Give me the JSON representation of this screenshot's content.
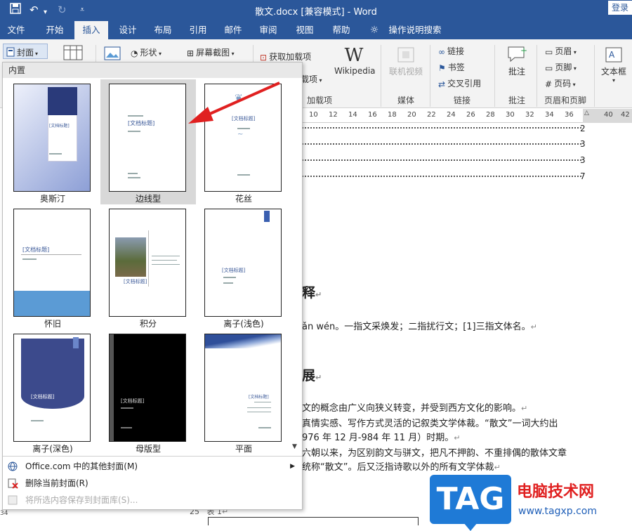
{
  "title_bar": {
    "doc_title": "散文.docx [兼容模式]  -  Word",
    "login": "登录"
  },
  "ribbon_tabs": [
    "文件",
    "开始",
    "插入",
    "设计",
    "布局",
    "引用",
    "邮件",
    "审阅",
    "视图",
    "帮助",
    "操作说明搜索"
  ],
  "ribbon": {
    "cover": "封面",
    "shapes": "形状",
    "screenshot": "屏幕截图",
    "get_addins": "获取加载项",
    "my_addins": "载项",
    "addins_group": "加载项",
    "wikipedia": "Wikipedia",
    "online_video": "联机视频",
    "media_group": "媒体",
    "link": "链接",
    "bookmark": "书签",
    "cross_ref": "交叉引用",
    "links_group": "链接",
    "comment": "批注",
    "comment_group": "批注",
    "header": "页眉",
    "footer": "页脚",
    "page_number": "页码",
    "hf_group": "页眉和页脚",
    "textbox": "文本框"
  },
  "ruler_ticks": [
    "10",
    "12",
    "14",
    "16",
    "18",
    "20",
    "22",
    "24",
    "26",
    "28",
    "30",
    "32",
    "34",
    "36",
    "40",
    "42"
  ],
  "toc_numbers": [
    "2",
    "3",
    "3",
    "7"
  ],
  "document": {
    "heading1": "释",
    "line1": "ǎn wén。一指文采焕发；二指扰行文；[1]三指文体名。",
    "heading2": "展",
    "line2": "文的概念由广义向狭义转变，并受到西方文化的影响。",
    "line3": "真情实感、写作方式灵活的记叙类文学体裁。“散文”一词大约出",
    "line4": "976 年 12 月-984 年 11 月）时期。",
    "line5": "六朝以来，为区别韵文与骈文，把凡不押韵、不重排偶的散体文章",
    "line6": "统称“散文”。后又泛指诗歌以外的所有文学体裁",
    "page_num": "25",
    "table_label": "表 1"
  },
  "gallery": {
    "section": "内置",
    "placeholder": "[文档标题]",
    "items": [
      {
        "label": "奥斯汀"
      },
      {
        "label": "边线型"
      },
      {
        "label": "花丝"
      },
      {
        "label": "怀旧"
      },
      {
        "label": "积分"
      },
      {
        "label": "离子(浅色)"
      },
      {
        "label": "离子(深色)"
      },
      {
        "label": "母版型"
      },
      {
        "label": "平面"
      }
    ],
    "selected_index": 1,
    "footer": {
      "more": "Office.com 中的其他封面(M)",
      "remove": "删除当前封面(R)",
      "save": "将所选内容保存到封面库(S)..."
    }
  },
  "watermark": {
    "badge": "TAG",
    "site_name": "电脑技术网",
    "url": "www.tagxp.com"
  },
  "left_ruler_num": "34",
  "colors": {
    "word_blue": "#2b579a",
    "tag_blue": "#1f7ad6",
    "tag_red": "#e02020",
    "arrow_red": "#e02020"
  }
}
